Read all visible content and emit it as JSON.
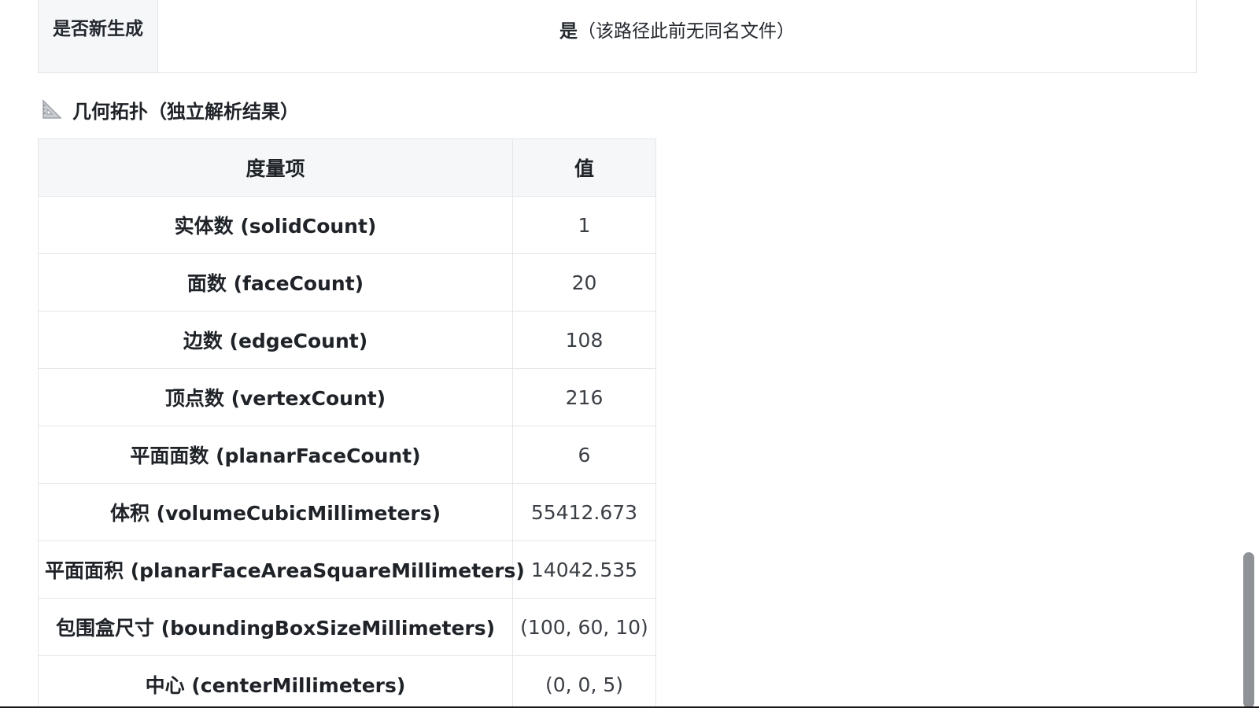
{
  "top_row": {
    "key": "是否新生成",
    "value_main": "是",
    "value_note": "（该路径此前无同名文件）"
  },
  "section": {
    "icon": "ruler-triangle-icon",
    "title": "几何拓扑（独立解析结果）"
  },
  "table": {
    "headers": [
      "度量项",
      "值"
    ],
    "rows": [
      {
        "name": "实体数 (solidCount)",
        "value": "1"
      },
      {
        "name": "面数 (faceCount)",
        "value": "20"
      },
      {
        "name": "边数 (edgeCount)",
        "value": "108"
      },
      {
        "name": "顶点数 (vertexCount)",
        "value": "216"
      },
      {
        "name": "平面面数 (planarFaceCount)",
        "value": "6"
      },
      {
        "name": "体积 (volumeCubicMillimeters)",
        "value": "55412.673"
      },
      {
        "name": "平面面积 (planarFaceAreaSquareMillimeters)",
        "value": "14042.535"
      },
      {
        "name": "包围盒尺寸 (boundingBoxSizeMillimeters)",
        "value": "(100, 60, 10)"
      },
      {
        "name": "中心 (centerMillimeters)",
        "value": "(0, 0, 5)"
      }
    ]
  }
}
